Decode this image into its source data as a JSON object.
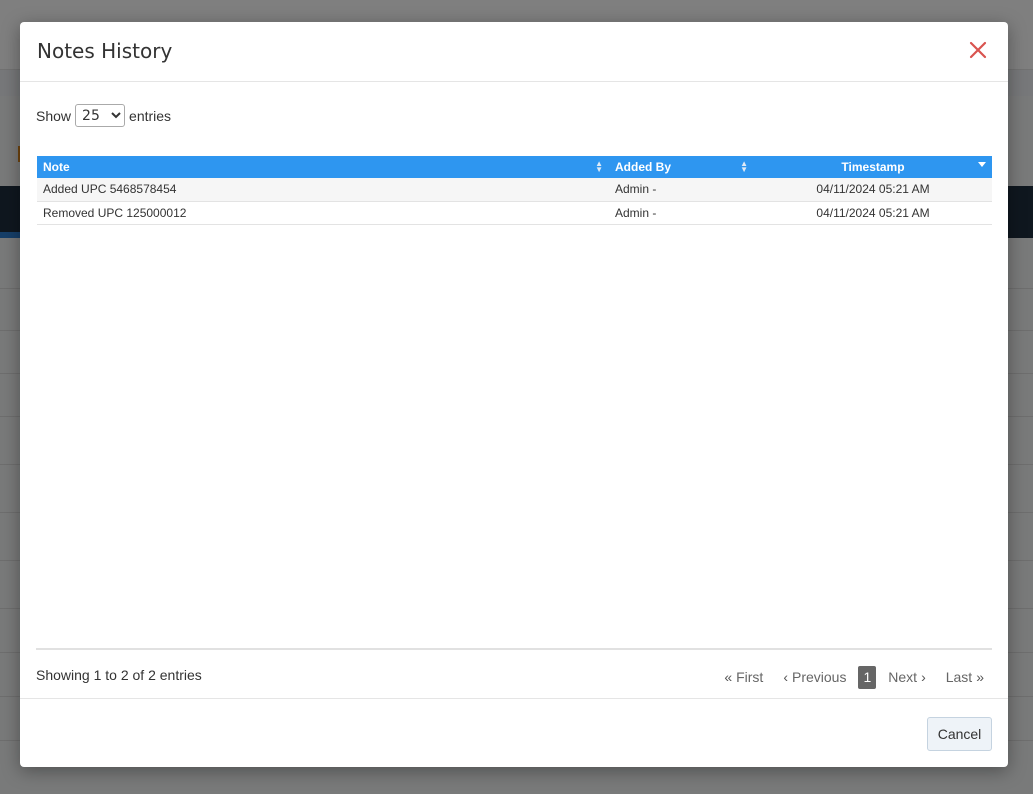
{
  "modal": {
    "title": "Notes History",
    "close_icon": "close-icon"
  },
  "length_menu": {
    "prefix": "Show",
    "selected": "25",
    "suffix": "entries"
  },
  "table": {
    "columns": [
      "Note",
      "Added By",
      "Timestamp"
    ],
    "rows": [
      {
        "note": "Added UPC 5468578454",
        "added_by": "Admin -",
        "timestamp": "04/11/2024 05:21 AM"
      },
      {
        "note": "Removed UPC 125000012",
        "added_by": "Admin -",
        "timestamp": "04/11/2024 05:21 AM"
      }
    ],
    "header_color": "#2e96f0"
  },
  "info": "Showing 1 to 2 of 2 entries",
  "pagination": {
    "first": "First",
    "previous": "Previous",
    "current": "1",
    "next": "Next",
    "last": "Last"
  },
  "footer": {
    "cancel_label": "Cancel"
  }
}
